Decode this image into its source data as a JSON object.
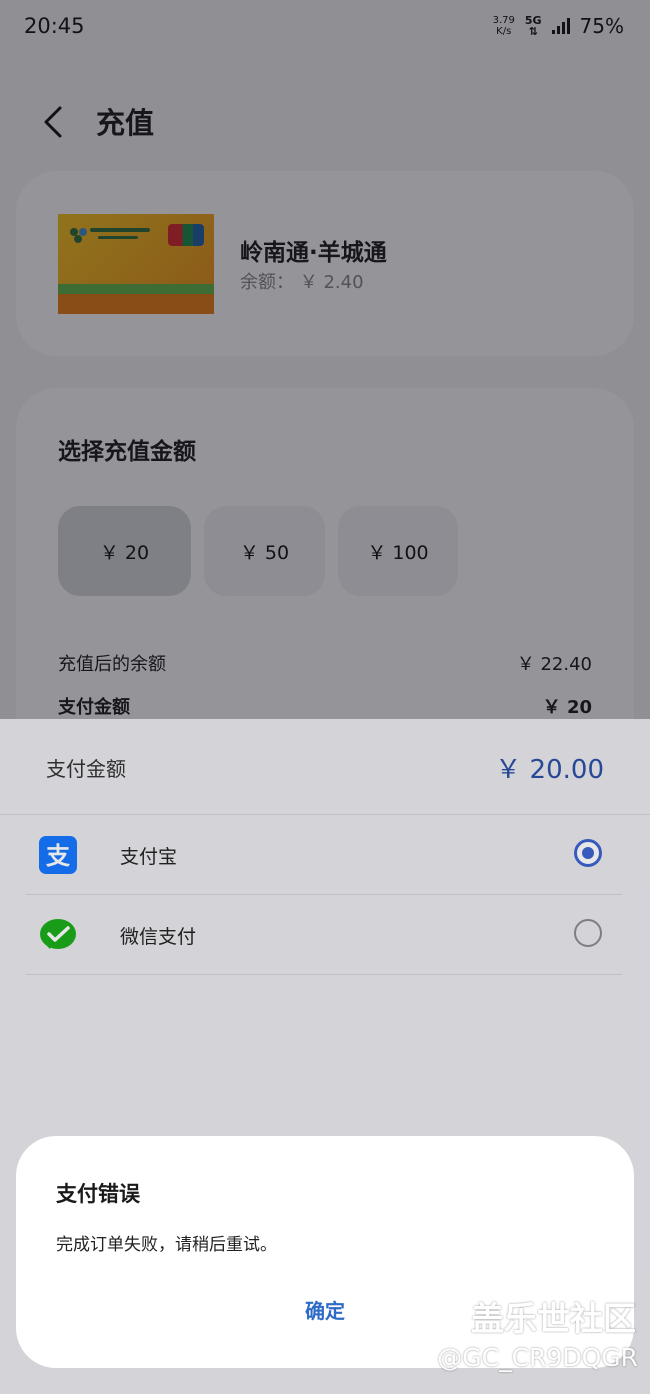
{
  "status": {
    "time": "20:45",
    "net_speed_value": "3.79",
    "net_speed_unit": "K/s",
    "network": "5G",
    "battery": "75%"
  },
  "header": {
    "title": "充值",
    "back_icon": "chevron-left-icon"
  },
  "card": {
    "name": "岭南通·羊城通",
    "balance": "余额： ￥ 2.40"
  },
  "amount": {
    "title": "选择充值金额",
    "options": [
      {
        "label": "￥ 20",
        "selected": true
      },
      {
        "label": "￥ 50",
        "selected": false
      },
      {
        "label": "￥ 100",
        "selected": false
      }
    ],
    "after_label": "充值后的余额",
    "after_value": "￥ 22.40",
    "pay_label": "支付金额",
    "pay_value": "￥ 20"
  },
  "payment_sheet": {
    "label": "支付金额",
    "amount": "￥ 20.00",
    "methods": [
      {
        "label": "支付宝",
        "icon": "alipay-icon",
        "selected": true,
        "color": "#1677ff"
      },
      {
        "label": "微信支付",
        "icon": "wechat-pay-icon",
        "selected": false,
        "color": "#1aad19"
      }
    ]
  },
  "dialog": {
    "title": "支付错误",
    "message": "完成订单失败，请稍后重试。",
    "confirm": "确定"
  },
  "watermark": {
    "line1": "盖乐世社区",
    "line2": "@GC_CR9DQGR"
  },
  "colors": {
    "accent": "#3d63cf",
    "amount_text": "#2a4fa2",
    "dialog_button": "#2e6bc6"
  }
}
